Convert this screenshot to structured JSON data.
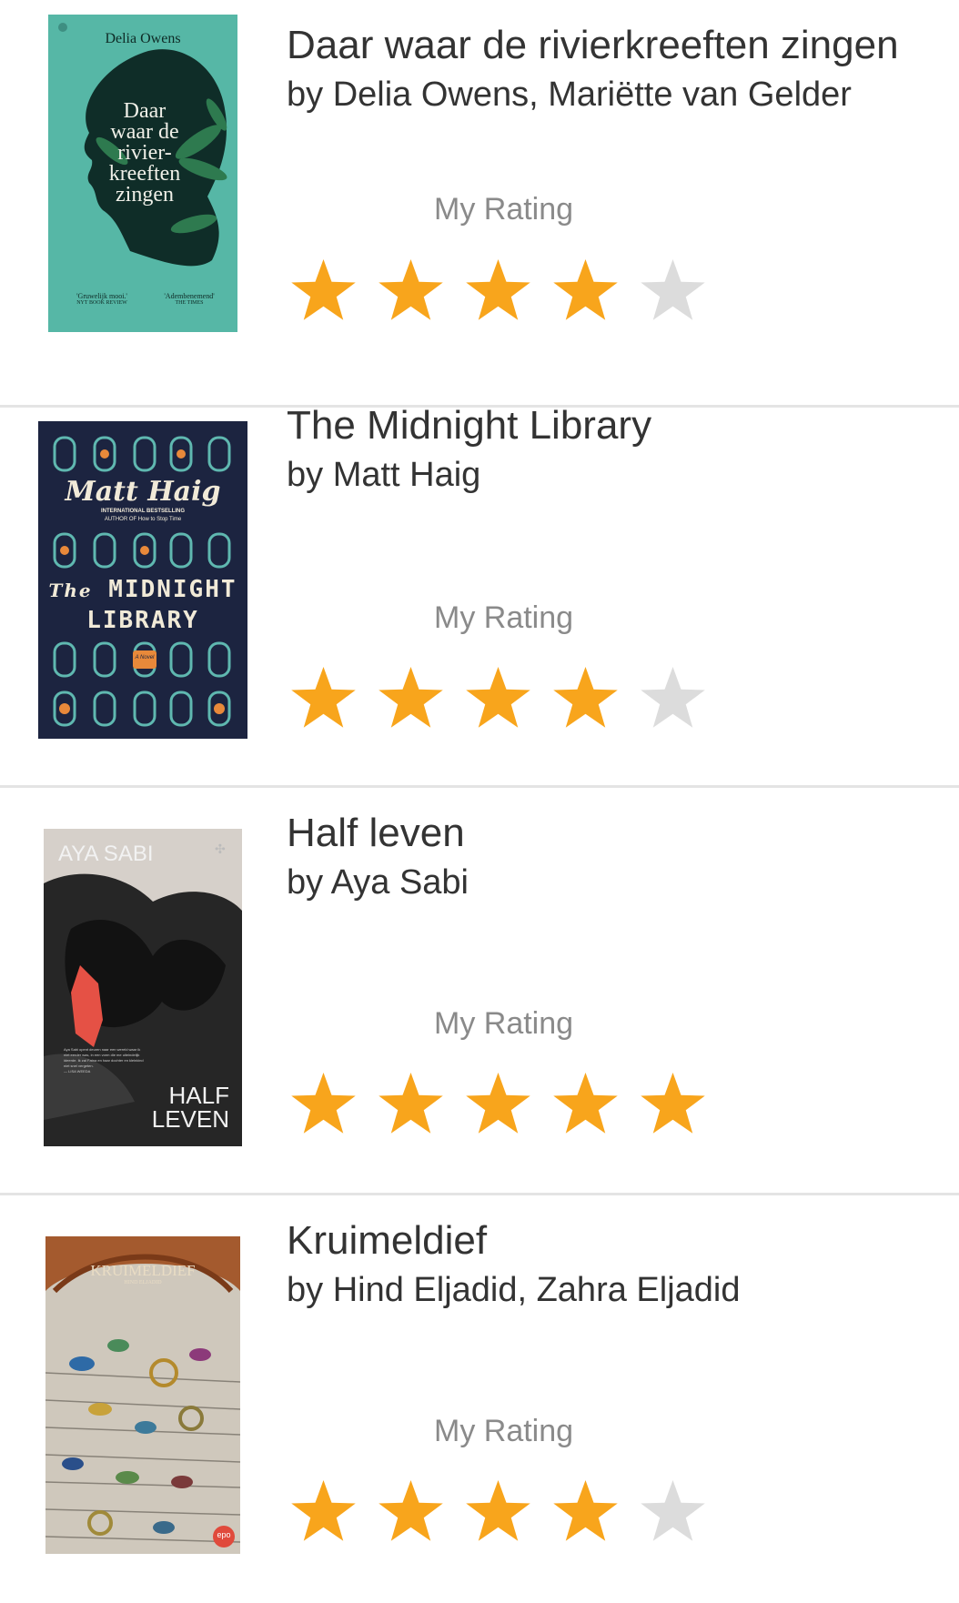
{
  "books": [
    {
      "title": "Daar waar de rivierkreeften zingen",
      "author": "by Delia Owens, Mariëtte van Gelder",
      "rating_label": "My Rating",
      "rating": 4,
      "max_rating": 5,
      "cover": {
        "author": "Delia Owens",
        "title_lines": [
          "Daar",
          "waar de",
          "rivier-",
          "kreeften",
          "zingen"
        ],
        "quote_left": "'Gruwelijk mooi.'",
        "source_left": "NYT BOOK REVIEW",
        "quote_right": "'Adembenemend'",
        "source_right": "THE TIMES"
      }
    },
    {
      "title": "The Midnight Library",
      "author": "by Matt Haig",
      "rating_label": "My Rating",
      "rating": 4,
      "max_rating": 5,
      "cover": {
        "author": "Matt Haig",
        "tagline1": "INTERNATIONAL BESTSELLING",
        "tagline2": "AUTHOR OF How to Stop Time",
        "title_the": "The",
        "title_line1": "MIDNIGHT",
        "title_line2": "LIBRARY",
        "badge": "A Novel"
      }
    },
    {
      "title": "Half leven",
      "author": "by Aya Sabi",
      "rating_label": "My Rating",
      "rating": 5,
      "max_rating": 5,
      "cover": {
        "author": "AYA SABI",
        "title_line1": "HALF",
        "title_line2": "LEVEN",
        "blurb": "Aya Sabi opent deuren naar een wereld waar ik niet eerder was, in een vorm die me uiteindelijk ideerde. Ik zal Fatna en haar dochter en kleinkind niet snel vergeten.",
        "blurb_source": "— LISA WEEDA"
      }
    },
    {
      "title": "Kruimeldief",
      "author": "by Hind Eljadid, Zahra Eljadid",
      "rating_label": "My Rating",
      "rating": 4,
      "max_rating": 5,
      "cover": {
        "title": "KRUIMELDIEF",
        "author": "HIND ELJADID",
        "publisher": "epo"
      }
    }
  ],
  "colors": {
    "star_filled": "#f8a51c",
    "star_empty": "#dcdcdc",
    "divider": "#e4e4e4",
    "text": "#333333",
    "label": "#8a8a8a"
  }
}
